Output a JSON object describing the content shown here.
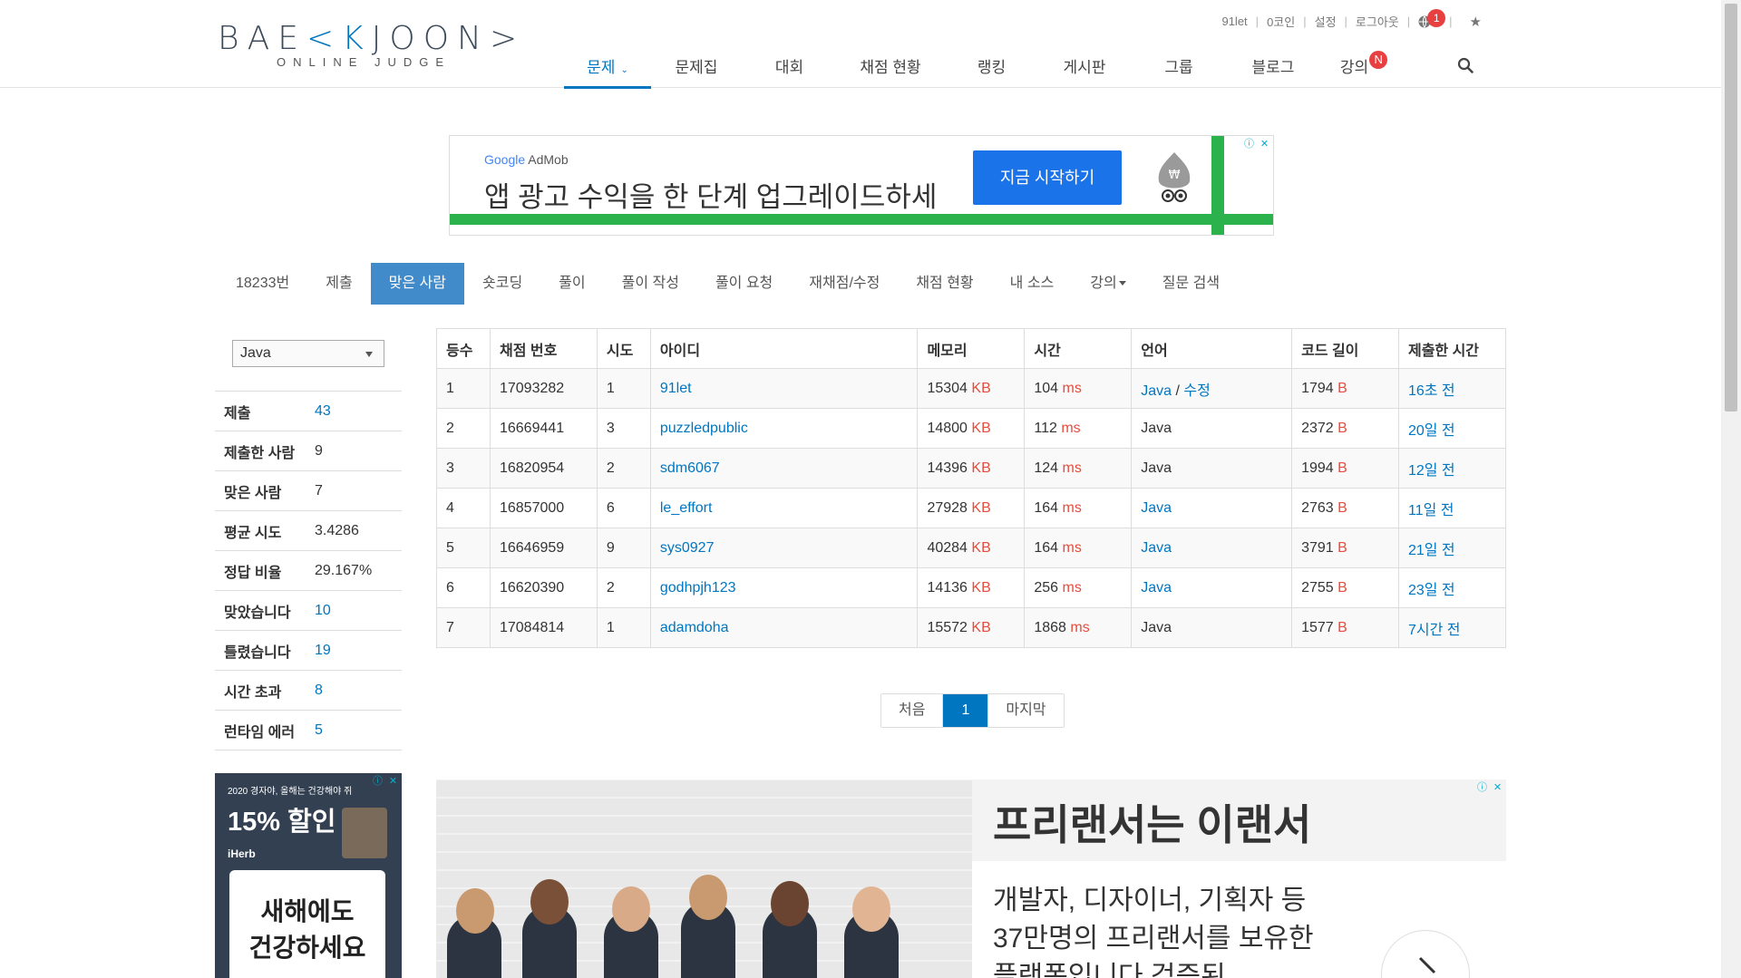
{
  "logo": {
    "main_a": "BAE",
    "main_k": "<K",
    "main_b": "JOON>",
    "sub": "ONLINE JUDGE"
  },
  "topbar": {
    "user": "91let",
    "coins": "0코인",
    "settings": "설정",
    "logout": "로그아웃",
    "notif_count": "1"
  },
  "nav": [
    {
      "label": "문제",
      "active": true
    },
    {
      "label": "문제집"
    },
    {
      "label": "대회"
    },
    {
      "label": "채점 현황"
    },
    {
      "label": "랭킹"
    },
    {
      "label": "게시판"
    },
    {
      "label": "그룹"
    },
    {
      "label": "블로그"
    },
    {
      "label": "강의",
      "badge": "N"
    }
  ],
  "ad_top": {
    "brand": "Google AdMob",
    "brand_google": "Google",
    "brand_rest": " AdMob",
    "headline": "앱 광고 수익을 한 단계 업그레이드하세",
    "cta": "지금 시작하기",
    "won": "₩"
  },
  "problem_tabs": [
    {
      "label": "18233번"
    },
    {
      "label": "제출"
    },
    {
      "label": "맞은 사람",
      "active": true
    },
    {
      "label": "숏코딩"
    },
    {
      "label": "풀이"
    },
    {
      "label": "풀이 작성"
    },
    {
      "label": "풀이 요청"
    },
    {
      "label": "재채점/수정"
    },
    {
      "label": "채점 현황"
    },
    {
      "label": "내 소스"
    },
    {
      "label": "강의"
    },
    {
      "label": "질문 검색"
    }
  ],
  "language_filter": "Java",
  "stats": [
    {
      "key": "제출",
      "value": "43",
      "link": true
    },
    {
      "key": "제출한 사람",
      "value": "9"
    },
    {
      "key": "맞은 사람",
      "value": "7"
    },
    {
      "key": "평균 시도",
      "value": "3.4286"
    },
    {
      "key": "정답 비율",
      "value": "29.167%"
    },
    {
      "key": "맞았습니다",
      "value": "10",
      "link": true
    },
    {
      "key": "틀렸습니다",
      "value": "19",
      "link": true
    },
    {
      "key": "시간 초과",
      "value": "8",
      "link": true
    },
    {
      "key": "런타임 에러",
      "value": "5",
      "link": true
    }
  ],
  "table": {
    "headers": [
      "등수",
      "채점 번호",
      "시도",
      "아이디",
      "메모리",
      "시간",
      "언어",
      "코드 길이",
      "제출한 시간"
    ],
    "mem_unit": "KB",
    "time_unit": "ms",
    "len_unit": "B",
    "rows": [
      {
        "rank": "1",
        "id": "17093282",
        "tries": "1",
        "user": "91let",
        "mem": "15304",
        "time": "104",
        "lang": "Java",
        "lang_link": true,
        "edit": "수정",
        "len": "1794",
        "when": "16초 전"
      },
      {
        "rank": "2",
        "id": "16669441",
        "tries": "3",
        "user": "puzzledpublic",
        "mem": "14800",
        "time": "112",
        "lang": "Java",
        "lang_link": false,
        "len": "2372",
        "when": "20일 전"
      },
      {
        "rank": "3",
        "id": "16820954",
        "tries": "2",
        "user": "sdm6067",
        "mem": "14396",
        "time": "124",
        "lang": "Java",
        "lang_link": false,
        "len": "1994",
        "when": "12일 전"
      },
      {
        "rank": "4",
        "id": "16857000",
        "tries": "6",
        "user": "le_effort",
        "mem": "27928",
        "time": "164",
        "lang": "Java",
        "lang_link": true,
        "len": "2763",
        "when": "11일 전"
      },
      {
        "rank": "5",
        "id": "16646959",
        "tries": "9",
        "user": "sys0927",
        "mem": "40284",
        "time": "164",
        "lang": "Java",
        "lang_link": true,
        "len": "3791",
        "when": "21일 전"
      },
      {
        "rank": "6",
        "id": "16620390",
        "tries": "2",
        "user": "godhpjh123",
        "mem": "14136",
        "time": "256",
        "lang": "Java",
        "lang_link": true,
        "len": "2755",
        "when": "23일 전"
      },
      {
        "rank": "7",
        "id": "17084814",
        "tries": "1",
        "user": "adamdoha",
        "mem": "15572",
        "time": "1868",
        "lang": "Java",
        "lang_link": false,
        "len": "1577",
        "when": "7시간 전"
      }
    ]
  },
  "pagination": {
    "first": "처음",
    "current": "1",
    "last": "마지막"
  },
  "ad_left": {
    "small": "2020 경자야, 올해는 건강해야 쥐",
    "pct": "15% 할인",
    "brand": "iHerb",
    "card_line1": "새해에도",
    "card_line2": "건강하세요"
  },
  "ad_right": {
    "title": "프리랜서는 이랜서",
    "desc_line1": "개발자, 디자이너, 기획자 등",
    "desc_line2": "37만명의 프리랜서를 보유한",
    "desc_line3": "플랫폼입니다 검증된"
  },
  "colors": {
    "accent": "#0076c0",
    "tab_active": "#428bca",
    "unit_red": "#e74c3c",
    "badge_red": "#e84040"
  }
}
